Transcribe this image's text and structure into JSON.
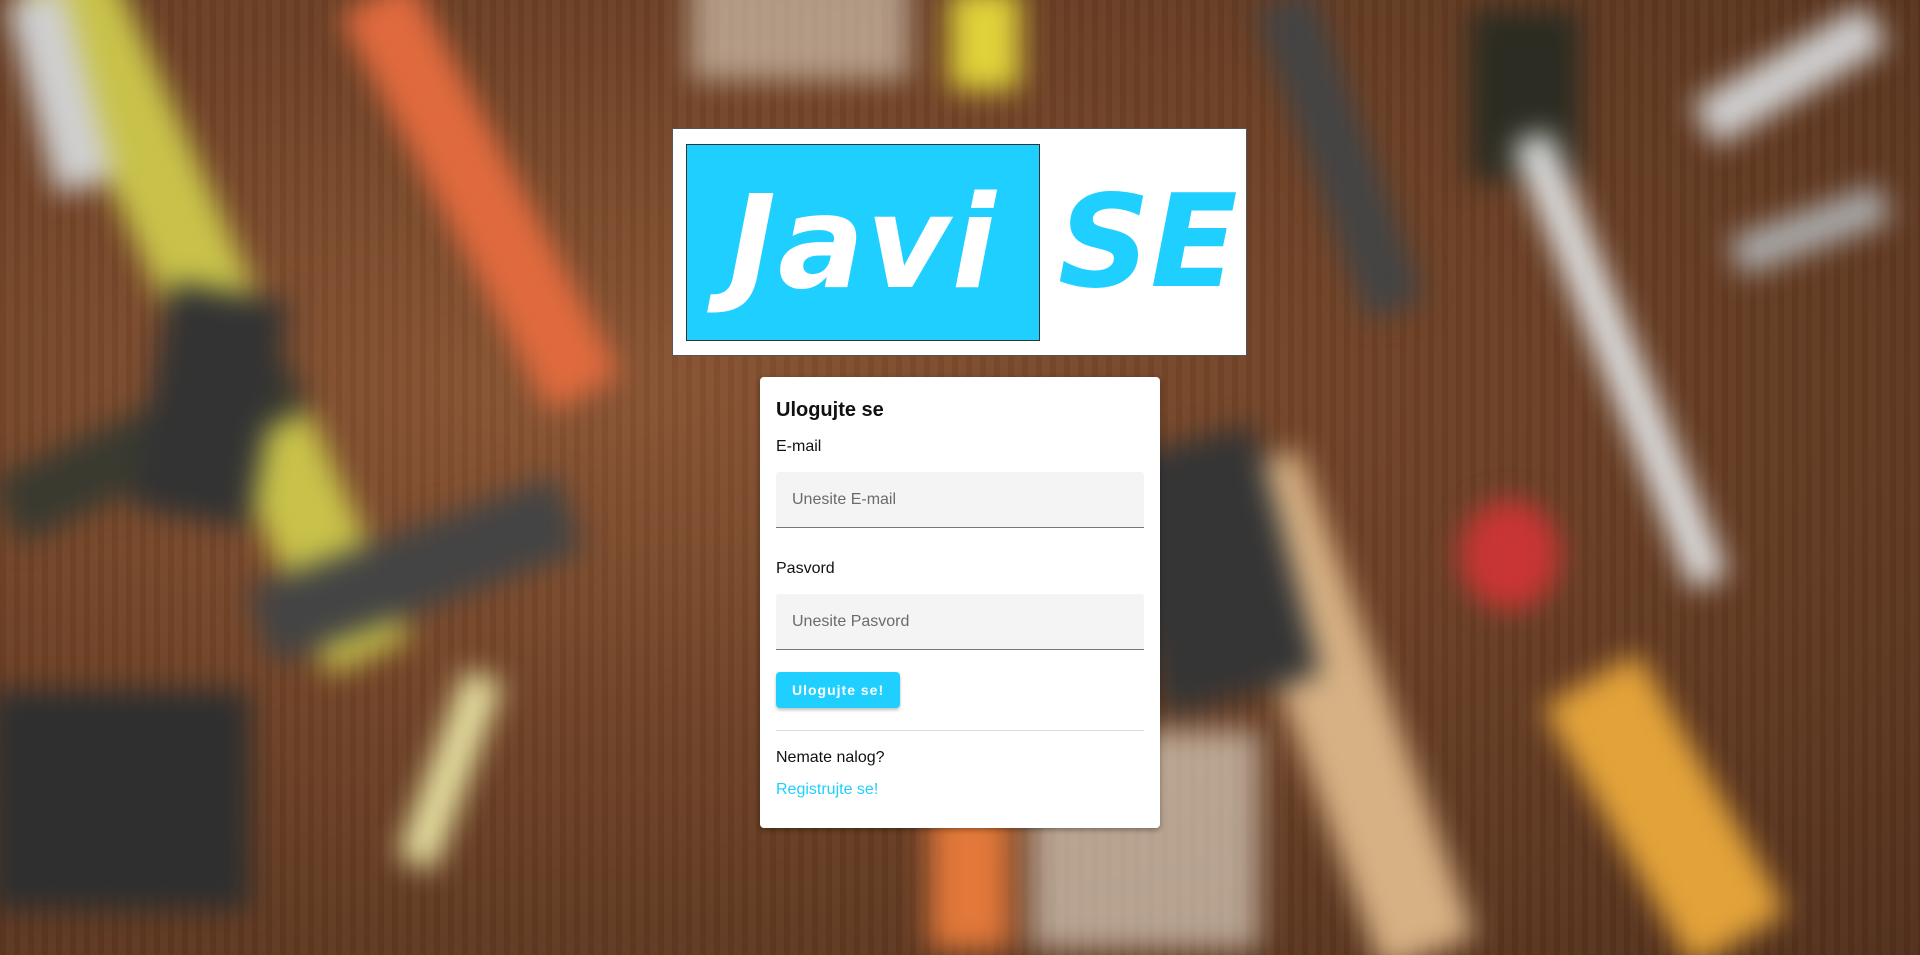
{
  "logo": {
    "part1": "Javi",
    "part2": "SE",
    "accent_color": "#1ecfff"
  },
  "login": {
    "title": "Ulogujte se",
    "email_label": "E-mail",
    "email_placeholder": "Unesite E-mail",
    "password_label": "Pasvord",
    "password_placeholder": "Unesite Pasvord",
    "submit_label": "Ulogujte se!",
    "no_account_text": "Nemate nalog?",
    "register_link": "Registrujte se!"
  }
}
